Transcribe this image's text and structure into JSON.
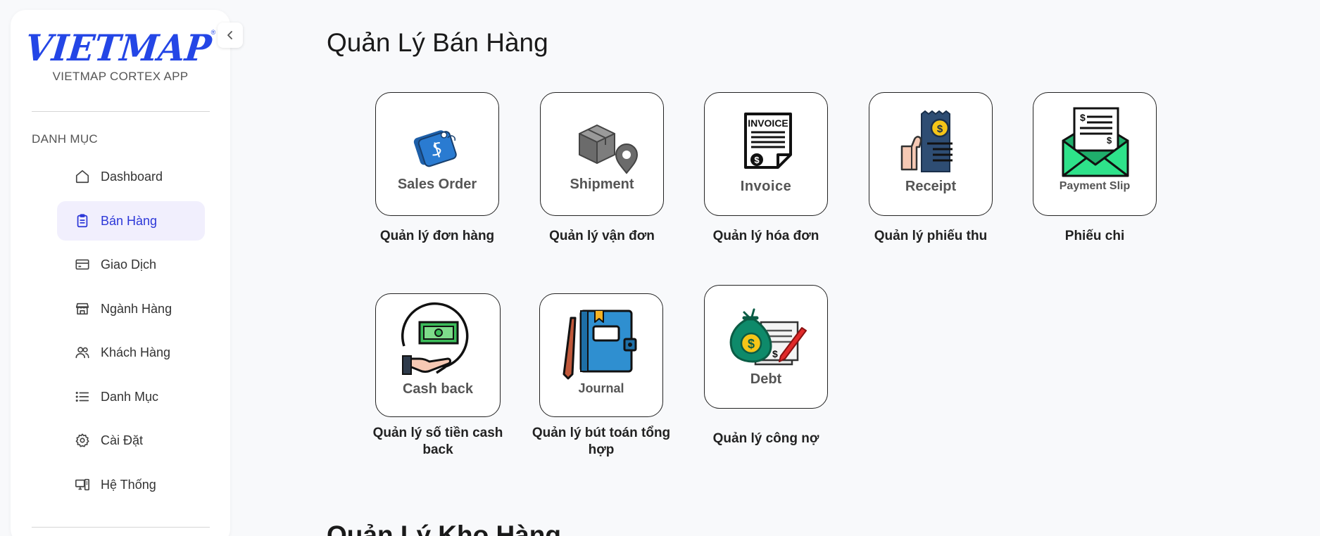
{
  "sidebar": {
    "logo": "VIETMAP",
    "logo_reg": "®",
    "app_name": "VIETMAP CORTEX APP",
    "section_label": "DANH MỤC",
    "items": [
      {
        "label": "Dashboard",
        "icon": "home-icon"
      },
      {
        "label": "Bán Hàng",
        "icon": "clipboard-icon",
        "active": true
      },
      {
        "label": "Giao Dịch",
        "icon": "card-icon"
      },
      {
        "label": "Ngành Hàng",
        "icon": "store-icon"
      },
      {
        "label": "Khách Hàng",
        "icon": "users-icon"
      },
      {
        "label": "Danh Mục",
        "icon": "list-icon"
      },
      {
        "label": "Cài Đặt",
        "icon": "gear-icon"
      },
      {
        "label": "Hệ Thống",
        "icon": "system-icon"
      }
    ]
  },
  "main": {
    "title": "Quản Lý Bán Hàng",
    "title_next": "Quản Lý Kho Hàng",
    "cards": [
      {
        "image_text": "Sales Order",
        "label": "Quản lý đơn hàng"
      },
      {
        "image_text": "Shipment",
        "label": "Quản lý vận đơn"
      },
      {
        "image_text": "Invoice",
        "label": "Quản lý hóa đơn"
      },
      {
        "image_text": "Receipt",
        "label": "Quản lý phiếu thu"
      },
      {
        "image_text": "Payment Slip",
        "label": "Phiếu chi"
      },
      {
        "image_text": "Cash back",
        "label": "Quản lý số tiền cash back"
      },
      {
        "image_text": "Journal",
        "label": "Quản lý bút toán tổng hợp"
      },
      {
        "image_text": "Debt",
        "label": "Quản lý công nợ"
      }
    ]
  },
  "colors": {
    "brand": "#2446e6",
    "active_bg": "#f1effd",
    "active_text": "#2c37d8"
  }
}
